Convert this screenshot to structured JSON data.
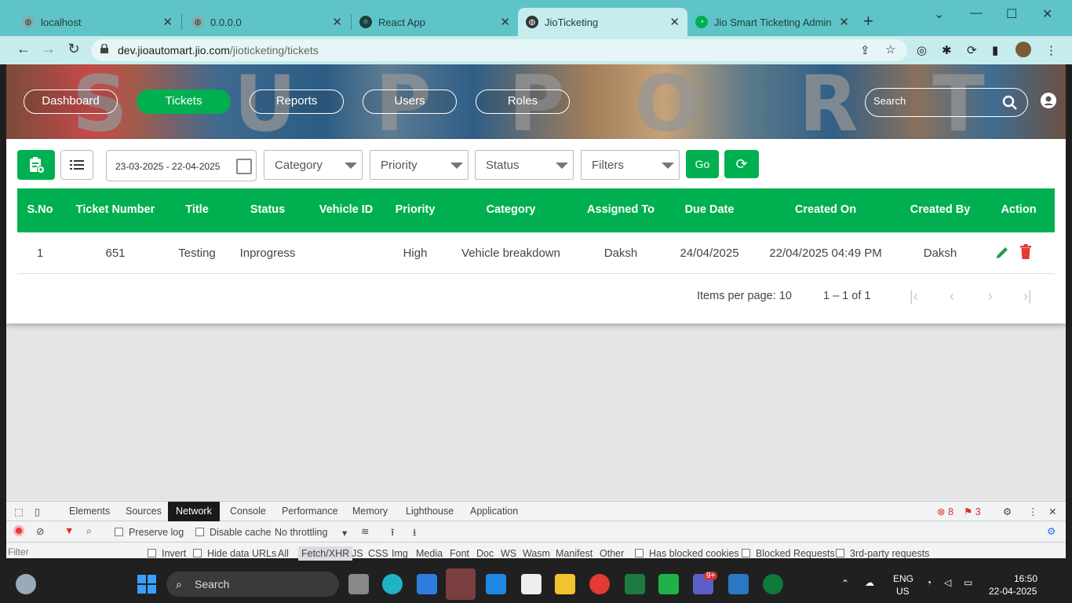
{
  "browser": {
    "tabs": [
      {
        "title": "localhost"
      },
      {
        "title": "0.0.0.0"
      },
      {
        "title": "React App"
      },
      {
        "title": "JioTicketing"
      },
      {
        "title": "Jio Smart Ticketing Admin"
      }
    ],
    "url_host": "dev.jioautomart.jio.com",
    "url_path": "/jioticketing/tickets"
  },
  "banner_letters": [
    "S",
    "U",
    "P",
    "P",
    "O",
    "R",
    "T"
  ],
  "nav": {
    "dashboard": "Dashboard",
    "tickets": "Tickets",
    "reports": "Reports",
    "users": "Users",
    "roles": "Roles",
    "search_placeholder": "Search"
  },
  "filters": {
    "date_range": "23-03-2025 - 22-04-2025",
    "category": "Category",
    "priority": "Priority",
    "status": "Status",
    "filters": "Filters",
    "go": "Go"
  },
  "table": {
    "headers": [
      "S.No",
      "Ticket Number",
      "Title",
      "Status",
      "Vehicle ID",
      "Priority",
      "Category",
      "Assigned To",
      "Due Date",
      "Created On",
      "Created By",
      "Action"
    ],
    "rows": [
      [
        "1",
        "651",
        "Testing",
        "Inprogress",
        "",
        "High",
        "Vehicle breakdown",
        "Daksh",
        "24/04/2025",
        "22/04/2025 04:49 PM",
        "Daksh"
      ]
    ]
  },
  "pagination": {
    "items_per_page": "Items per page: 10",
    "range": "1 – 1 of 1"
  },
  "devtools": {
    "tabs": [
      "Elements",
      "Sources",
      "Network",
      "Console",
      "Performance",
      "Memory",
      "Lighthouse",
      "Application"
    ],
    "errors": "8",
    "issues": "3",
    "preserve_log": "Preserve log",
    "disable_cache": "Disable cache",
    "throttling": "No throttling",
    "filter_placeholder": "Filter",
    "invert": "Invert",
    "hide_data_urls": "Hide data URLs",
    "types": [
      "All",
      "Fetch/XHR",
      "JS",
      "CSS",
      "Img",
      "Media",
      "Font",
      "Doc",
      "WS",
      "Wasm",
      "Manifest",
      "Other"
    ],
    "has_blocked_cookies": "Has blocked cookies",
    "blocked_requests": "Blocked Requests",
    "third_party": "3rd-party requests"
  },
  "taskbar": {
    "search": "Search",
    "lang": "ENG",
    "region": "US",
    "time": "16:50",
    "date": "22-04-2025",
    "teams_badge": "9+"
  },
  "colors": {
    "accent": "#00b050",
    "chrome": "#5fc4c8",
    "delete": "#e53935"
  }
}
